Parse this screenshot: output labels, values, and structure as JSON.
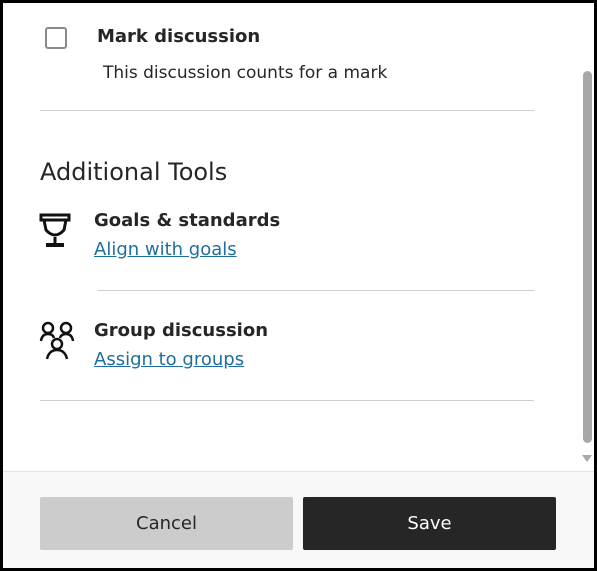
{
  "mark_discussion": {
    "checked": false,
    "title": "Mark discussion",
    "description": "This discussion counts for a mark"
  },
  "additional_tools": {
    "heading": "Additional Tools",
    "goals": {
      "icon": "trophy-icon",
      "title": "Goals & standards",
      "link": "Align with goals"
    },
    "groups": {
      "icon": "group-people-icon",
      "title": "Group discussion",
      "link": "Assign to groups"
    }
  },
  "footer": {
    "cancel_label": "Cancel",
    "save_label": "Save"
  },
  "colors": {
    "link": "#1f6f9c",
    "primary_button": "#262626",
    "secondary_button": "#cccccc"
  }
}
